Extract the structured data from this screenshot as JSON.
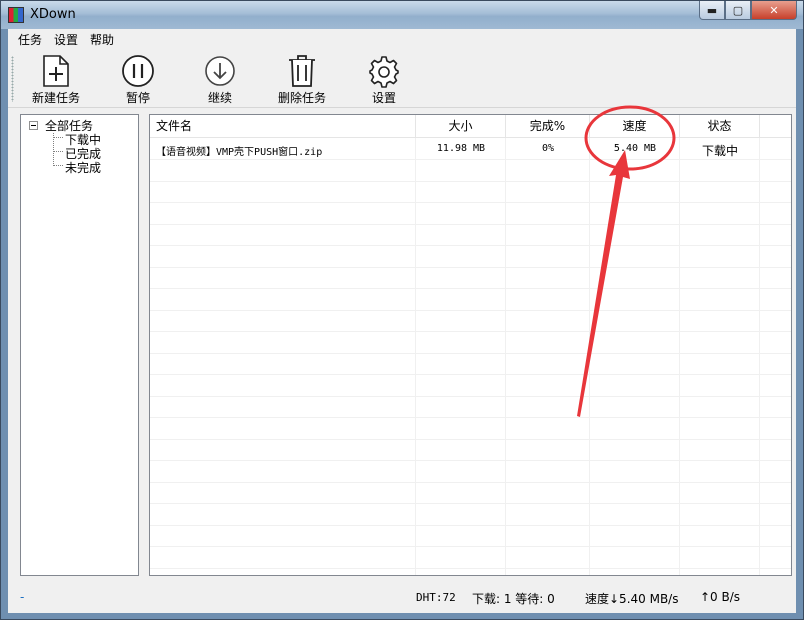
{
  "window": {
    "title": "XDown",
    "min_glyph": "▬",
    "max_glyph": "▢",
    "close_glyph": "✕"
  },
  "menu": [
    "任务",
    "设置",
    "帮助"
  ],
  "toolbar": {
    "new_task": "新建任务",
    "pause": "暂停",
    "resume": "继续",
    "delete_task": "删除任务",
    "settings": "设置"
  },
  "tree": {
    "root": "全部任务",
    "children": [
      "下载中",
      "已完成",
      "未完成"
    ]
  },
  "list": {
    "columns": [
      "文件名",
      "大小",
      "完成%",
      "速度",
      "状态"
    ],
    "rows": [
      {
        "name": "【语音视频】VMP壳下PUSH窗口.zip",
        "size": "11.98 MB",
        "percent": "0%",
        "speed": "5.40 MB",
        "status": "下载中"
      }
    ]
  },
  "status": {
    "left": "-",
    "dht": "DHT:72",
    "downloading": "下载: 1 等待: 0",
    "speed_down": "速度↓5.40 MB/s",
    "speed_up": "↑0 B/s"
  },
  "colors": {
    "annotation": "#e8363b"
  }
}
